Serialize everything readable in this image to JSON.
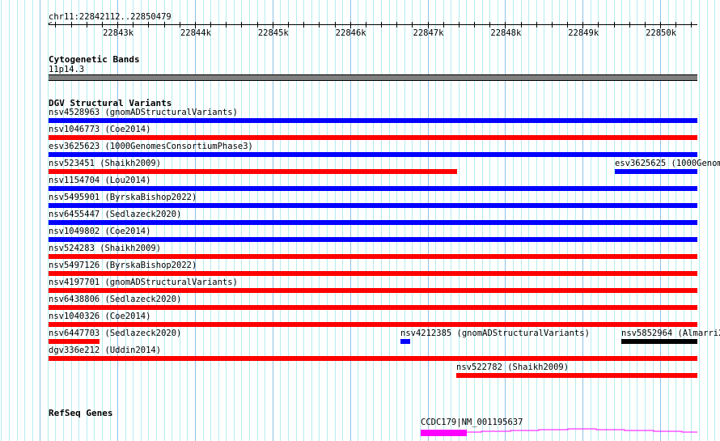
{
  "view": {
    "location": "chr11:22842112..22850479",
    "start": 22842112,
    "end": 22850479,
    "ticks": [
      "22843k",
      "22844k",
      "22845k",
      "22846k",
      "22847k",
      "22848k",
      "22849k",
      "22850k"
    ]
  },
  "cyto": {
    "title": "Cytogenetic Bands",
    "band": "11p14.3",
    "band_color": "#808080"
  },
  "dgv": {
    "title": "DGV Structural Variants",
    "colors": {
      "blue": "#0000ff",
      "red": "#ff0000",
      "black": "#000000"
    },
    "rows": [
      [
        {
          "label": "nsv4528963 (gnomADStructuralVariants)",
          "color": "blue",
          "start": 22842112,
          "end": 22850479
        }
      ],
      [
        {
          "label": "nsv1046773 (Coe2014)",
          "color": "red",
          "start": 22842112,
          "end": 22850479
        }
      ],
      [
        {
          "label": "esv3625623 (1000GenomesConsortiumPhase3)",
          "color": "blue",
          "start": 22842112,
          "end": 22850479
        }
      ],
      [
        {
          "label": "nsv523451 (Shaikh2009)",
          "color": "red",
          "start": 22842112,
          "end": 22847385
        },
        {
          "label": "esv3625625 (1000Genome",
          "color": "blue",
          "start": 22849417,
          "end": 22850479
        }
      ],
      [
        {
          "label": "nsv1154704 (Lou2014)",
          "color": "blue",
          "start": 22842112,
          "end": 22850479
        }
      ],
      [
        {
          "label": "nsv5495901 (ByrskaBishop2022)",
          "color": "blue",
          "start": 22842112,
          "end": 22850479
        }
      ],
      [
        {
          "label": "nsv6455447 (Sedlazeck2020)",
          "color": "blue",
          "start": 22842112,
          "end": 22850479
        }
      ],
      [
        {
          "label": "nsv1049802 (Coe2014)",
          "color": "blue",
          "start": 22842112,
          "end": 22850479
        }
      ],
      [
        {
          "label": "nsv524283 (Shaikh2009)",
          "color": "red",
          "start": 22842112,
          "end": 22850479
        }
      ],
      [
        {
          "label": "nsv5497126 (ByrskaBishop2022)",
          "color": "red",
          "start": 22842112,
          "end": 22850479
        }
      ],
      [
        {
          "label": "nsv4197701 (gnomADStructuralVariants)",
          "color": "red",
          "start": 22842112,
          "end": 22850479
        }
      ],
      [
        {
          "label": "nsv6438806 (Sedlazeck2020)",
          "color": "red",
          "start": 22842112,
          "end": 22850479
        }
      ],
      [
        {
          "label": "nsv1040326 (Coe2014)",
          "color": "red",
          "start": 22842112,
          "end": 22850479
        }
      ],
      [
        {
          "label": "nsv6447703 (Sedlazeck2020)",
          "color": "red",
          "start": 22842112,
          "end": 22842771
        },
        {
          "label": "nsv4212385 (gnomADStructuralVariants)",
          "color": "blue",
          "start": 22846646,
          "end": 22846771
        },
        {
          "label": "nsv5852964 (Almarri20",
          "color": "black",
          "start": 22849500,
          "end": 22850479
        }
      ],
      [
        {
          "label": "dgv336e212 (Uddin2014)",
          "color": "red",
          "start": 22842112,
          "end": 22850479
        }
      ],
      [
        {
          "label": "nsv522782 (Shaikh2009)",
          "color": "red",
          "start": 22847375,
          "end": 22850479
        }
      ]
    ]
  },
  "refseq": {
    "title": "RefSeq Genes",
    "gene": {
      "label": "CCDC179|NM_001195637",
      "color": "#ff00ff",
      "thick_start": 22846906,
      "thick_end": 22847510,
      "end": 22850479
    }
  }
}
